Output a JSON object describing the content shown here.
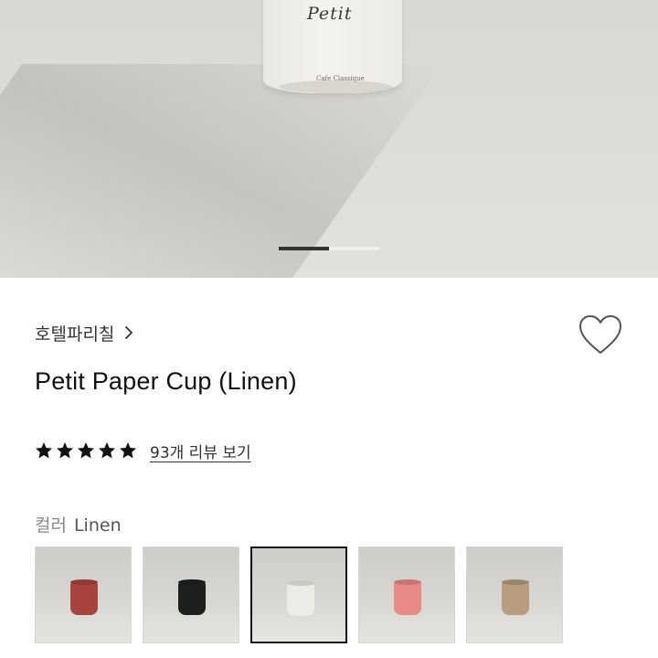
{
  "hero": {
    "cup_brand_text": "Petit",
    "cup_sub_text": "Cafe Classique",
    "carousel_progress": 0.5
  },
  "brand": {
    "name": "호텔파리칠",
    "chevron_icon": "chevron-right-icon"
  },
  "wishlist": {
    "icon": "heart-outline-icon"
  },
  "product": {
    "title": "Petit Paper Cup (Linen)"
  },
  "rating": {
    "stars": 5,
    "max_stars": 5,
    "star_color": "#111111",
    "review_link": "93개 리뷰 보기"
  },
  "color_option": {
    "label": "컬러",
    "selected_value": "Linen",
    "swatches": [
      {
        "cup_color": "#a8443f",
        "selected": false
      },
      {
        "cup_color": "#1d1f1e",
        "selected": false
      },
      {
        "cup_color": "#ecebe6",
        "selected": true
      },
      {
        "cup_color": "#e88a86",
        "selected": false
      },
      {
        "cup_color": "#b89c7e",
        "selected": false
      }
    ]
  }
}
